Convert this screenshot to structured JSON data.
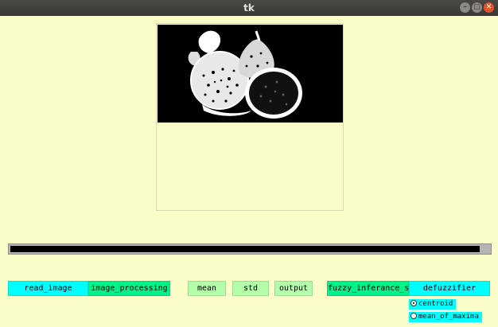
{
  "window": {
    "title": "tk"
  },
  "image_panel": {
    "icon": "processed-fruit-image"
  },
  "progress": {
    "value": 0.98
  },
  "buttons": {
    "read_image": "read_image",
    "image_processing": "image_processing",
    "mean": "mean",
    "std": "std",
    "output": "output",
    "fuzzy": "fuzzy_inferance_system",
    "defuzzifier": "defuzzifier"
  },
  "radios": [
    {
      "label": "centroid",
      "selected": true
    },
    {
      "label": "mean_of_maxima",
      "selected": false
    }
  ]
}
